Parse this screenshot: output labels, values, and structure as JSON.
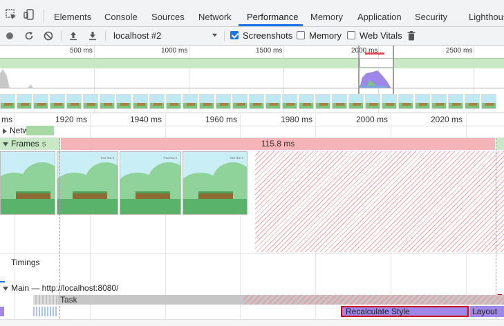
{
  "tabs": [
    "Elements",
    "Console",
    "Sources",
    "Network",
    "Performance",
    "Memory",
    "Application",
    "Security",
    "Lighthous"
  ],
  "active_tab": "Performance",
  "toolbar": {
    "target": "localhost #2",
    "screenshots_label": "Screenshots",
    "memory_label": "Memory",
    "webvitals_label": "Web Vitals",
    "screenshots_checked": true,
    "memory_checked": false,
    "webvitals_checked": false
  },
  "overview": {
    "ticks": [
      "500 ms",
      "1000 ms",
      "1500 ms",
      "2000 ms",
      "2500 ms"
    ]
  },
  "ruler": {
    "labels": [
      "ms",
      "1920 ms",
      "1940 ms",
      "1960 ms",
      "1980 ms",
      "2000 ms",
      "2020 ms"
    ]
  },
  "tracks": {
    "network": "Network",
    "frames": "Frames",
    "frames_partial": "s",
    "frame_duration": "115.8 ms",
    "timings": "Timings",
    "main": "Main — http://localhost:8080/",
    "task": "Task",
    "recalc": "Recalculate Style",
    "layout": "Layout"
  },
  "colors": {
    "accent": "#1a73e8",
    "frame_bar": "#f4b4b8",
    "green": "#a8d8a3",
    "purple": "#9e87e7",
    "task_gray": "#c6c6c6",
    "selected": "#d0021b"
  }
}
